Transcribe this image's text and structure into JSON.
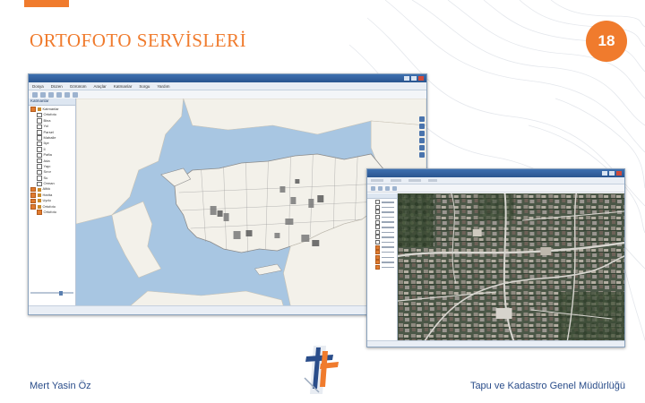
{
  "slide": {
    "title": "ORTOFOTO SERVİSLERİ",
    "page_number": "18",
    "author": "Mert Yasin Öz",
    "organization": "Tapu ve Kadastro Genel Müdürlüğü",
    "accent_color": "#f07b2d",
    "footer_color": "#2a4d8a"
  },
  "main_window": {
    "menu": [
      "Dosya",
      "Düzen",
      "Görünüm",
      "Araçlar",
      "Katmanlar",
      "Sorgu",
      "Yardım"
    ],
    "sidebar_header": "Katmanlar",
    "layers": [
      {
        "label": "Katmanlar",
        "type": "folder",
        "checked": true,
        "indent": 0
      },
      {
        "label": "Ortofoto",
        "type": "layer",
        "checked": false,
        "indent": 1
      },
      {
        "label": "Bina",
        "type": "layer",
        "checked": false,
        "indent": 1
      },
      {
        "label": "Yol",
        "type": "layer",
        "checked": false,
        "indent": 1
      },
      {
        "label": "Parsel",
        "type": "layer",
        "checked": false,
        "indent": 1
      },
      {
        "label": "Mahalle",
        "type": "layer",
        "checked": false,
        "indent": 1
      },
      {
        "label": "İlçe",
        "type": "layer",
        "checked": false,
        "indent": 1
      },
      {
        "label": "İl",
        "type": "layer",
        "checked": false,
        "indent": 1
      },
      {
        "label": "Pafta",
        "type": "layer",
        "checked": false,
        "indent": 1
      },
      {
        "label": "Ada",
        "type": "layer",
        "checked": false,
        "indent": 1
      },
      {
        "label": "Yapı",
        "type": "layer",
        "checked": false,
        "indent": 1
      },
      {
        "label": "Sınır",
        "type": "layer",
        "checked": false,
        "indent": 1
      },
      {
        "label": "Su",
        "type": "layer",
        "checked": false,
        "indent": 1
      },
      {
        "label": "Orman",
        "type": "layer",
        "checked": false,
        "indent": 1
      },
      {
        "label": "Altlık",
        "type": "folder",
        "checked": true,
        "indent": 0
      },
      {
        "label": "Harita",
        "type": "folder",
        "checked": true,
        "indent": 0
      },
      {
        "label": "Uydu",
        "type": "folder",
        "checked": true,
        "indent": 0
      },
      {
        "label": "Ortofoto",
        "type": "folder",
        "checked": true,
        "indent": 0
      },
      {
        "label": "Ortofoto",
        "type": "layer",
        "checked": true,
        "indent": 1
      }
    ],
    "opacity_label": "",
    "opacity_value": 0.66,
    "footer_links": [
      "",
      ""
    ],
    "status_text": ""
  },
  "ortho_window": {
    "menu": [
      "",
      "",
      "",
      "",
      "",
      ""
    ],
    "layers_checked": [
      false,
      false,
      false,
      false,
      false,
      false,
      false,
      false,
      false,
      true,
      true,
      true,
      true,
      true
    ]
  },
  "map_colors": {
    "sea": "#a8c6e2",
    "land": "#f3f1ea",
    "province_border": "#8a8a8a",
    "ortho_tiles": "#7a7a7a"
  }
}
